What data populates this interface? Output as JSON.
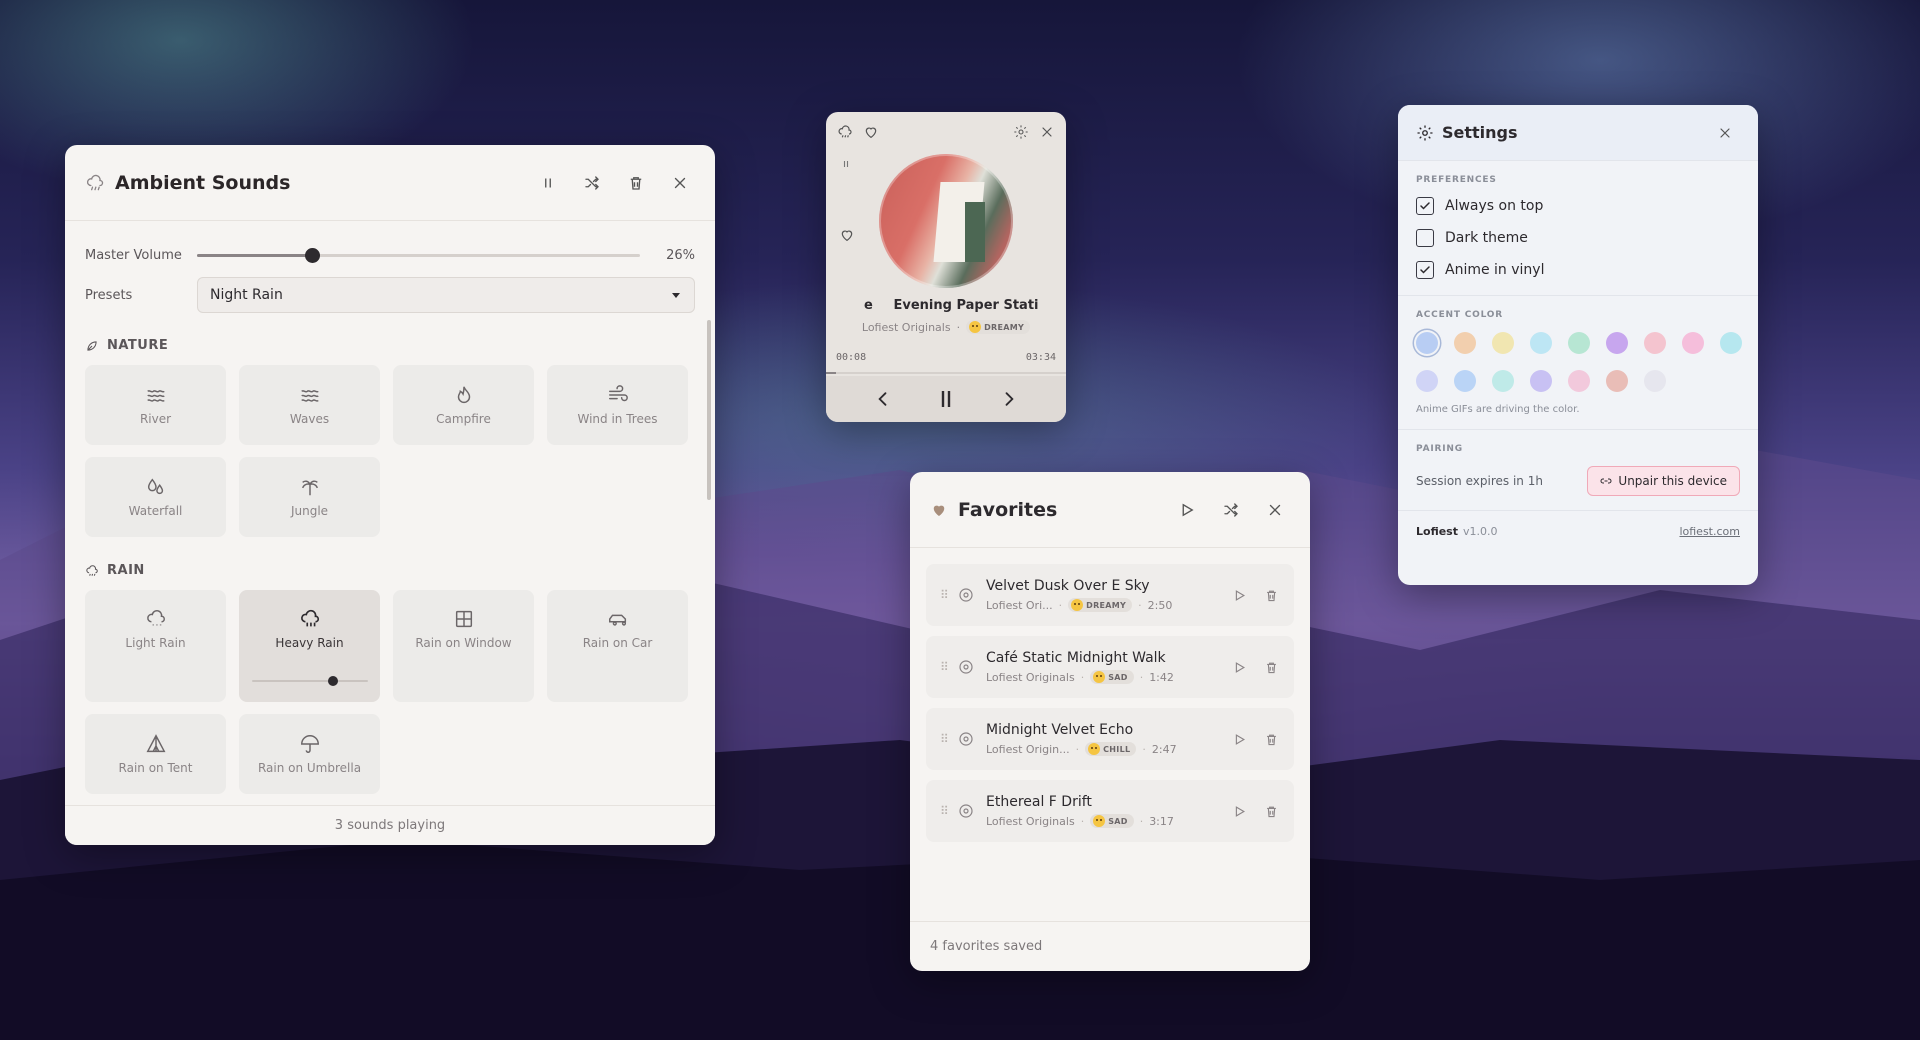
{
  "ambient": {
    "title": "Ambient Sounds",
    "master_volume_label": "Master Volume",
    "master_volume_value": "26%",
    "master_volume_level": 0.26,
    "presets_label": "Presets",
    "preset_selected": "Night Rain",
    "categories": {
      "nature": {
        "title": "NATURE",
        "tiles": [
          "River",
          "Waves",
          "Campfire",
          "Wind in Trees",
          "Waterfall",
          "Jungle"
        ]
      },
      "rain": {
        "title": "RAIN",
        "tiles": [
          "Light Rain",
          "Heavy Rain",
          "Rain on Window",
          "Rain on Car",
          "Rain on Tent",
          "Rain on Umbrella"
        ],
        "active": "Heavy Rain",
        "active_volume": 0.7
      }
    },
    "footer": "3 sounds playing"
  },
  "player": {
    "track_prefix": "e",
    "track_title": "Evening Paper Stati",
    "artist": "Lofiest Originals",
    "mood": "DREAMY",
    "time_current": "00:08",
    "time_total": "03:34",
    "progress": 0.04
  },
  "favorites": {
    "title": "Favorites",
    "items": [
      {
        "name": "Velvet Dusk Over E Sky",
        "artist": "Lofiest Ori...",
        "mood": "DREAMY",
        "duration": "2:50"
      },
      {
        "name": "Café Static Midnight Walk",
        "artist": "Lofiest Originals",
        "mood": "SAD",
        "duration": "1:42"
      },
      {
        "name": "Midnight Velvet Echo",
        "artist": "Lofiest Origin...",
        "mood": "CHILL",
        "duration": "2:47"
      },
      {
        "name": "Ethereal F Drift",
        "artist": "Lofiest Originals",
        "mood": "SAD",
        "duration": "3:17"
      }
    ],
    "footer": "4 favorites saved"
  },
  "settings": {
    "title": "Settings",
    "preferences_title": "PREFERENCES",
    "prefs": [
      {
        "label": "Always on top",
        "checked": true
      },
      {
        "label": "Dark theme",
        "checked": false
      },
      {
        "label": "Anime in vinyl",
        "checked": true
      }
    ],
    "accent_title": "ACCENT COLOR",
    "accent_colors": [
      "#b8cdf3",
      "#f2cfae",
      "#f1e6b1",
      "#bde6f4",
      "#b7e6d3",
      "#c7a6ee",
      "#f4c4cf",
      "#f5bedb",
      "#b6e7ef",
      "#d0d4f6",
      "#bad4f6",
      "#bfeae8",
      "#c8c1f3",
      "#f2c9dc",
      "#e9bdb7",
      "#e6e6ee"
    ],
    "accent_selected_index": 0,
    "accent_note": "Anime GIFs are driving the color.",
    "pairing_title": "PAIRING",
    "session_text": "Session expires in 1h",
    "unpair_label": "Unpair this device",
    "brand": "Lofiest",
    "version": "v1.0.0",
    "site": "lofiest.com"
  }
}
